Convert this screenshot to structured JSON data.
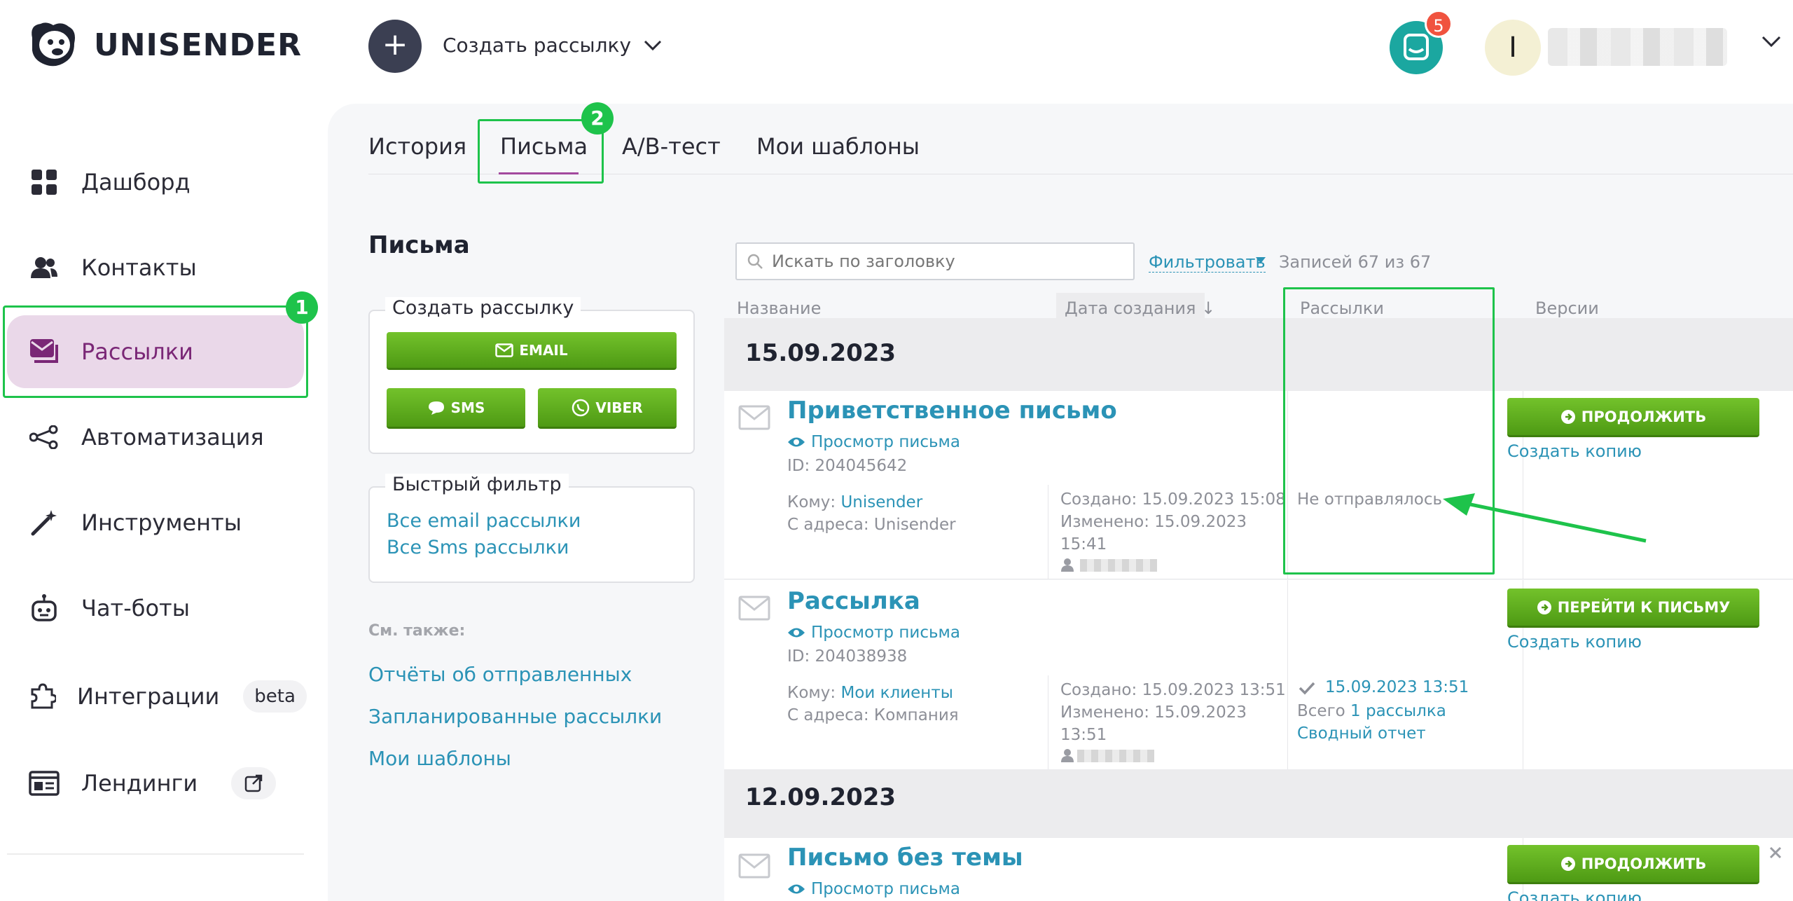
{
  "header": {
    "brand": "UNISENDER",
    "create_icon": "+",
    "create_label": "Создать рассылку",
    "chat_badge": "5",
    "avatar_letter": "I"
  },
  "sidebar": {
    "items": [
      {
        "label": "Дашборд",
        "icon": "grid-icon"
      },
      {
        "label": "Контакты",
        "icon": "users-icon"
      },
      {
        "label": "Рассылки",
        "icon": "mail-stack-icon",
        "active": true
      },
      {
        "label": "Автоматизация",
        "icon": "share-nodes-icon"
      },
      {
        "label": "Инструменты",
        "icon": "magic-wand-icon"
      },
      {
        "label": "Чат-боты",
        "icon": "robot-icon"
      },
      {
        "label": "Интеграции",
        "icon": "puzzle-icon",
        "badge": "beta"
      },
      {
        "label": "Лендинги",
        "icon": "landing-icon"
      }
    ],
    "annotation_badge": "1"
  },
  "tabs": {
    "items": [
      "История",
      "Письма",
      "A/B-тест",
      "Мои шаблоны"
    ],
    "active": "Письма",
    "annotation_badge": "2"
  },
  "page": {
    "title": "Письма",
    "create_box": {
      "legend": "Создать рассылку",
      "email": "EMAIL",
      "sms": "SMS",
      "viber": "VIBER"
    },
    "quick_filter": {
      "legend": "Быстрый фильтр",
      "links": [
        "Все email рассылки",
        "Все Sms рассылки"
      ]
    },
    "see_also": {
      "label": "См. также:",
      "links": [
        "Отчёты об отправленных",
        "Запланированные рассылки",
        "Мои шаблоны"
      ]
    }
  },
  "table": {
    "search_placeholder": "Искать по заголовку",
    "filter_label": "Фильтровать",
    "records": "Записей 67 из 67",
    "columns": [
      "Название",
      "Дата создания ↓",
      "Рассылки",
      "Версии"
    ],
    "groups": [
      {
        "date": "15.09.2023",
        "rows": [
          {
            "title": "Приветственное письмо",
            "view_link": "Просмотр письма",
            "id": "ID: 204045642",
            "to_label": "Кому:",
            "to_value": "Unisender",
            "from": "С адреса: Unisender",
            "created": "Создано: 15.09.2023 15:08",
            "modified_1": "Изменено: 15.09.2023",
            "modified_2": "15:41",
            "status": "Не отправлялось",
            "action": "ПРОДОЛЖИТЬ",
            "copy": "Создать копию"
          },
          {
            "title": "Рассылка",
            "view_link": "Просмотр письма",
            "id": "ID: 204038938",
            "to_label": "Кому:",
            "to_value": "Мои клиенты",
            "from": "С адреса: Компания",
            "created": "Создано: 15.09.2023 13:51",
            "modified_1": "Изменено: 15.09.2023",
            "modified_2": "13:51",
            "sent_date": "15.09.2023 13:51",
            "total_label": "Всего",
            "total_link": "1 рассылка",
            "report": "Сводный отчет",
            "action": "ПЕРЕЙТИ К ПИСЬМУ",
            "copy": "Создать копию"
          }
        ]
      },
      {
        "date": "12.09.2023",
        "rows": [
          {
            "title": "Письмо без темы",
            "view_link": "Просмотр письма",
            "action": "ПРОДОЛЖИТЬ",
            "copy": "Создать копию"
          }
        ]
      }
    ]
  },
  "colors": {
    "accent_green": "#1ec34b",
    "button_green": "#5fae1f",
    "link_blue": "#2b93b6",
    "active_nav_bg": "#ead8e9",
    "active_nav_text": "#7a2776"
  }
}
